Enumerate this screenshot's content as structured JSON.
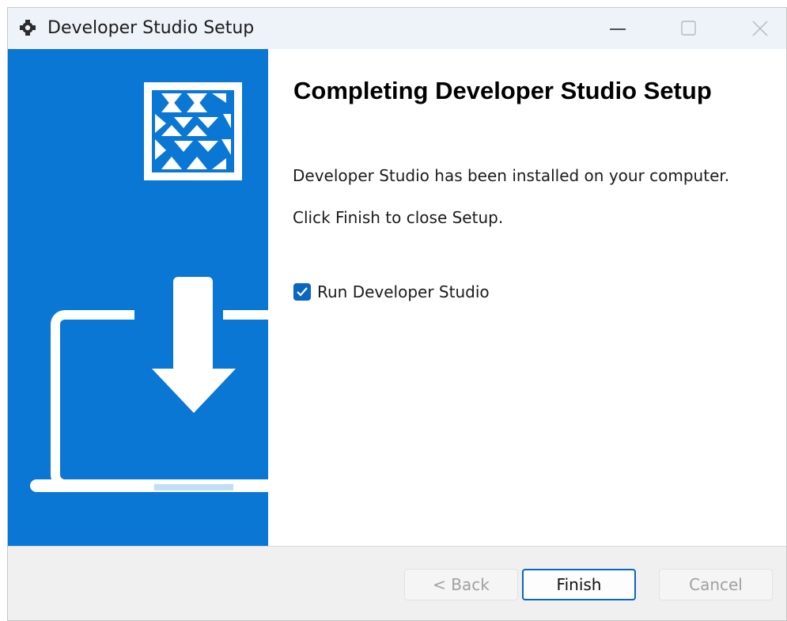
{
  "window": {
    "title": "Developer Studio Setup",
    "icon": "gear-puzzle-icon",
    "controls": {
      "minimize": "minimize-icon",
      "maximize": "maximize-icon",
      "close": "close-icon"
    }
  },
  "sidebar": {
    "background": "#0a77d4",
    "logo": "installer-logo-icon",
    "illustration": "laptop-download-icon"
  },
  "main": {
    "heading": "Completing Developer Studio Setup",
    "message_installed": "Developer Studio has been installed on your computer.",
    "message_finish": "Click Finish to close Setup.",
    "run_checkbox": {
      "label": "Run Developer Studio",
      "checked": true
    }
  },
  "footer": {
    "back_label": "< Back",
    "finish_label": "Finish",
    "cancel_label": "Cancel",
    "accent": "#0a66c2"
  }
}
